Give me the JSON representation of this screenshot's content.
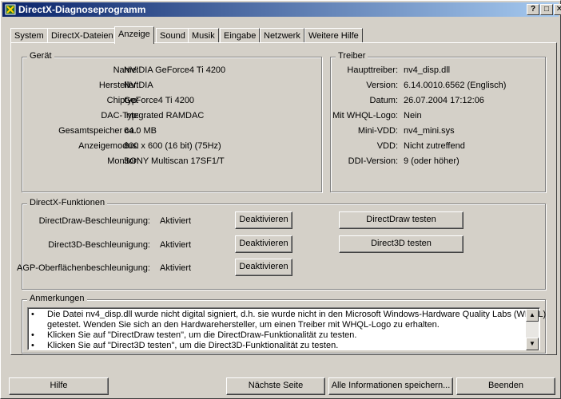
{
  "window": {
    "title": "DirectX-Diagnoseprogramm",
    "controls": [
      "?",
      "□",
      "✕"
    ]
  },
  "tabs": [
    {
      "label": "System"
    },
    {
      "label": "DirectX-Dateien"
    },
    {
      "label": "Anzeige"
    },
    {
      "label": "Sound"
    },
    {
      "label": "Musik"
    },
    {
      "label": "Eingabe"
    },
    {
      "label": "Netzwerk"
    },
    {
      "label": "Weitere Hilfe"
    }
  ],
  "active_tab": "Anzeige",
  "geraet": {
    "legend": "Gerät",
    "rows": [
      {
        "label": "Name:",
        "value": "NVIDIA GeForce4 Ti 4200"
      },
      {
        "label": "Hersteller:",
        "value": "NVIDIA"
      },
      {
        "label": "Chiptyp:",
        "value": "GeForce4 Ti 4200"
      },
      {
        "label": "DAC-Typ:",
        "value": "Integrated RAMDAC"
      },
      {
        "label": "Gesamtspeicher ca.:",
        "value": "64.0 MB"
      },
      {
        "label": "Anzeigemodus:",
        "value": "800 x 600 (16 bit) (75Hz)"
      },
      {
        "label": "Monitor:",
        "value": "SONY Multiscan 17SF1/T"
      }
    ]
  },
  "treiber": {
    "legend": "Treiber",
    "rows": [
      {
        "label": "Haupttreiber:",
        "value": "nv4_disp.dll"
      },
      {
        "label": "Version:",
        "value": "6.14.0010.6562 (Englisch)"
      },
      {
        "label": "Datum:",
        "value": "26.07.2004 17:12:06"
      },
      {
        "label": "Mit WHQL-Logo:",
        "value": "Nein"
      },
      {
        "label": "Mini-VDD:",
        "value": "nv4_mini.sys"
      },
      {
        "label": "VDD:",
        "value": "Nicht zutreffend"
      },
      {
        "label": "DDI-Version:",
        "value": "9 (oder höher)"
      }
    ]
  },
  "directx": {
    "legend": "DirectX-Funktionen",
    "rows": [
      {
        "label": "DirectDraw-Beschleunigung:",
        "status": "Aktiviert",
        "toggle": "Deaktivieren",
        "test": "DirectDraw testen"
      },
      {
        "label": "Direct3D-Beschleunigung:",
        "status": "Aktiviert",
        "toggle": "Deaktivieren",
        "test": "Direct3D testen"
      },
      {
        "label": "AGP-Oberflächenbeschleunigung:",
        "status": "Aktiviert",
        "toggle": "Deaktivieren"
      }
    ]
  },
  "anmerkungen": {
    "legend": "Anmerkungen",
    "lines": [
      {
        "bullet": "•",
        "text": "Die Datei nv4_disp.dll wurde nicht digital signiert, d.h. sie wurde nicht in den Microsoft Windows-Hardware Quality Labs (WHQL)"
      },
      {
        "bullet": "",
        "text": "getestet. Wenden Sie sich an den Hardwarehersteller, um einen Treiber mit WHQL-Logo zu erhalten."
      },
      {
        "bullet": "•",
        "text": "Klicken Sie auf \"DirectDraw testen\", um die DirectDraw-Funktionalität zu testen."
      },
      {
        "bullet": "•",
        "text": "Klicken Sie auf \"Direct3D testen\", um die Direct3D-Funktionalität zu testen."
      }
    ],
    "scroll_up_icon": "▲",
    "scroll_down_icon": "▼"
  },
  "footer": {
    "help": "Hilfe",
    "next": "Nächste Seite",
    "save": "Alle Informationen speichern...",
    "exit": "Beenden"
  }
}
